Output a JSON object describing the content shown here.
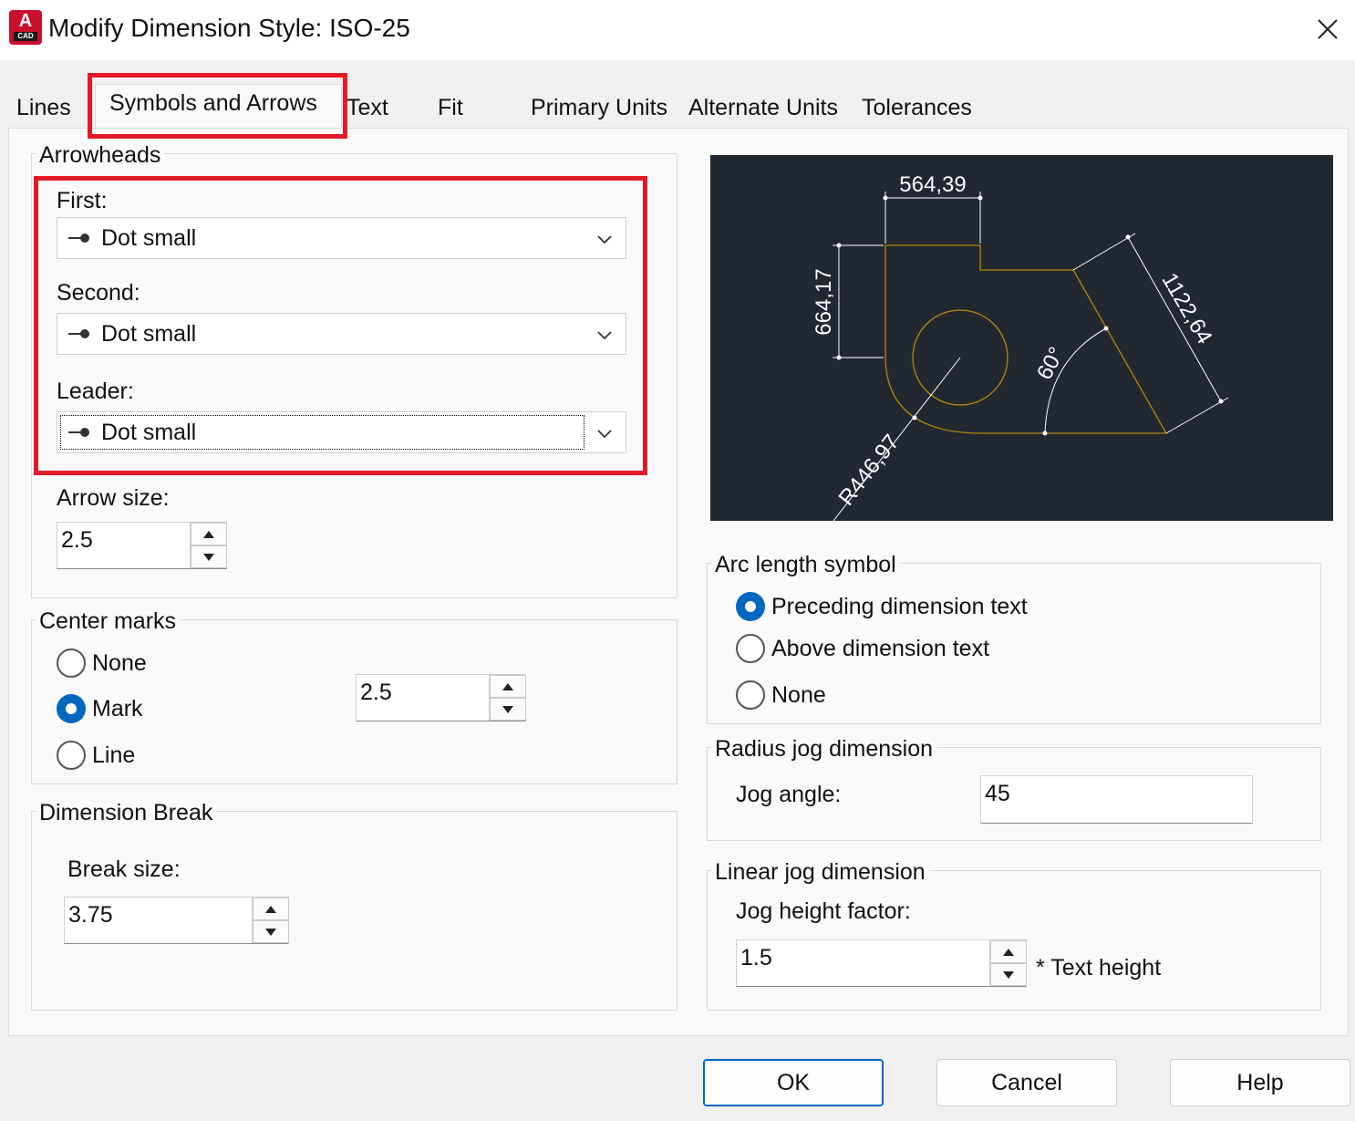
{
  "window": {
    "title": "Modify Dimension Style: ISO-25",
    "app_icon_letter": "A",
    "app_icon_sub": "CAD",
    "close_icon": "close-icon"
  },
  "tabs": [
    {
      "label": "Lines"
    },
    {
      "label": "Symbols and Arrows",
      "active": true
    },
    {
      "label": "Text"
    },
    {
      "label": "Fit"
    },
    {
      "label": "Primary Units"
    },
    {
      "label": "Alternate Units"
    },
    {
      "label": "Tolerances"
    }
  ],
  "arrowheads": {
    "title": "Arrowheads",
    "first_label": "First:",
    "first_value": "Dot small",
    "second_label": "Second:",
    "second_value": "Dot small",
    "leader_label": "Leader:",
    "leader_value": "Dot small",
    "arrow_size_label": "Arrow size:",
    "arrow_size_value": "2.5"
  },
  "center_marks": {
    "title": "Center marks",
    "options": [
      "None",
      "Mark",
      "Line"
    ],
    "selected": "Mark",
    "size_value": "2.5"
  },
  "dimension_break": {
    "title": "Dimension Break",
    "break_size_label": "Break size:",
    "break_size_value": "3.75"
  },
  "preview": {
    "dim_top": "564,39",
    "dim_left": "664,17",
    "dim_diag": "1122,64",
    "dim_angle": "60°",
    "dim_radius": "R446,97"
  },
  "arc_length_symbol": {
    "title": "Arc length symbol",
    "options": [
      "Preceding dimension text",
      "Above dimension text",
      "None"
    ],
    "selected": "Preceding dimension text"
  },
  "radius_jog": {
    "title": "Radius jog dimension",
    "jog_angle_label": "Jog angle:",
    "jog_angle_value": "45"
  },
  "linear_jog": {
    "title": "Linear jog dimension",
    "jog_height_label": "Jog height factor:",
    "jog_height_value": "1.5",
    "suffix": "* Text height"
  },
  "buttons": {
    "ok": "OK",
    "cancel": "Cancel",
    "help": "Help"
  },
  "colors": {
    "highlight": "#e21b27",
    "accent": "#0067c0",
    "preview_bg": "#212830",
    "geometry": "#b8860b",
    "dim_lines": "#ffffff"
  }
}
